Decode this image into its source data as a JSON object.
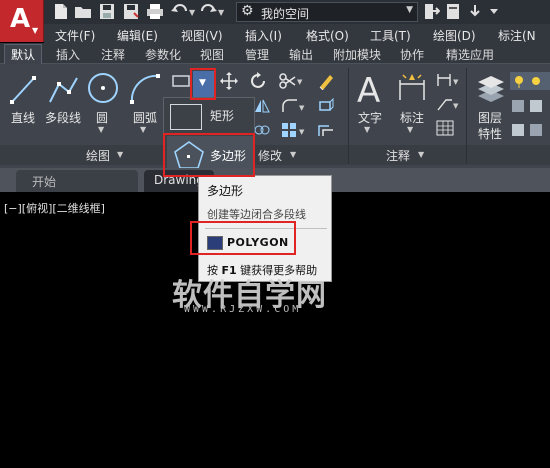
{
  "app": {
    "logo_letter": "A",
    "workspace": "我的空间"
  },
  "menu": [
    "文件(F)",
    "编辑(E)",
    "视图(V)",
    "插入(I)",
    "格式(O)",
    "工具(T)",
    "绘图(D)",
    "标注(N"
  ],
  "ribbon_tabs": [
    "默认",
    "插入",
    "注释",
    "参数化",
    "视图",
    "管理",
    "输出",
    "附加模块",
    "协作",
    "精选应用"
  ],
  "draw_panel": {
    "title": "绘图",
    "tools": [
      "直线",
      "多段线",
      "圆",
      "圆弧"
    ]
  },
  "modify_panel": {
    "title": "修改"
  },
  "annot_panel": {
    "title": "注释",
    "tools": [
      "文字",
      "标注"
    ]
  },
  "layer_panel": {
    "tools": [
      "图层",
      "特性"
    ]
  },
  "flyout": {
    "rect": "矩形",
    "polygon": "多边形"
  },
  "doc_tabs": {
    "start": "开始",
    "drawing": "Drawing"
  },
  "viewport_label": "[−][俯视][二维线框]",
  "tooltip": {
    "title": "多边形",
    "desc": "创建等边闭合多段线",
    "command": "POLYGON",
    "help_prefix": "按 ",
    "help_key": "F1",
    "help_suffix": " 键获得更多帮助"
  },
  "watermark": {
    "main": "软件自学网",
    "sub": "WWW.RJZXW.COM"
  },
  "colors": {
    "highlight": "#e02424",
    "app_button": "#c3282d"
  }
}
